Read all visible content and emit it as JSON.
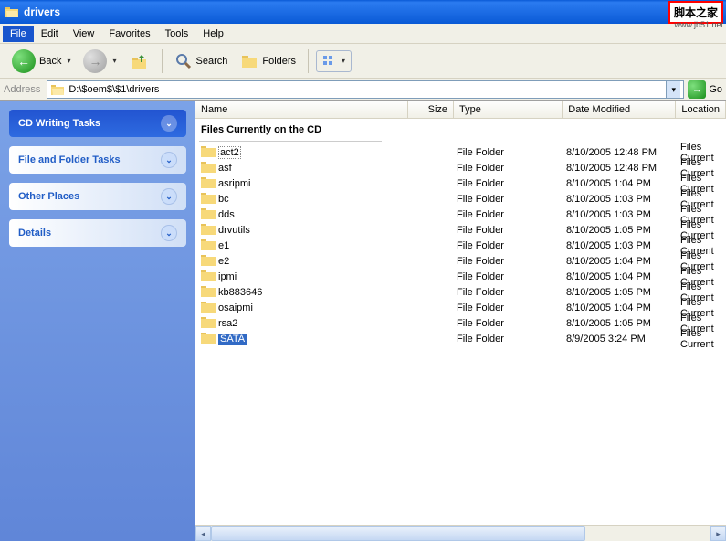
{
  "window": {
    "title": "drivers"
  },
  "watermark": {
    "text": "脚本之家",
    "url": "www.jb51.net"
  },
  "menu": {
    "file": "File",
    "edit": "Edit",
    "view": "View",
    "favorites": "Favorites",
    "tools": "Tools",
    "help": "Help"
  },
  "toolbar": {
    "back": "Back",
    "search": "Search",
    "folders": "Folders"
  },
  "address": {
    "label": "Address",
    "path": "D:\\$oem$\\$1\\drivers",
    "go": "Go"
  },
  "sidebar": {
    "panels": [
      {
        "title": "CD Writing Tasks",
        "primary": true
      },
      {
        "title": "File and Folder Tasks",
        "primary": false
      },
      {
        "title": "Other Places",
        "primary": false
      },
      {
        "title": "Details",
        "primary": false
      }
    ]
  },
  "columns": {
    "name": "Name",
    "size": "Size",
    "type": "Type",
    "date": "Date Modified",
    "location": "Location"
  },
  "section": "Files Currently on the CD",
  "files": [
    {
      "name": "act2",
      "type": "File Folder",
      "date": "8/10/2005 12:48 PM",
      "location": "Files Current",
      "focused": true
    },
    {
      "name": "asf",
      "type": "File Folder",
      "date": "8/10/2005 12:48 PM",
      "location": "Files Current"
    },
    {
      "name": "asripmi",
      "type": "File Folder",
      "date": "8/10/2005 1:04 PM",
      "location": "Files Current"
    },
    {
      "name": "bc",
      "type": "File Folder",
      "date": "8/10/2005 1:03 PM",
      "location": "Files Current"
    },
    {
      "name": "dds",
      "type": "File Folder",
      "date": "8/10/2005 1:03 PM",
      "location": "Files Current"
    },
    {
      "name": "drvutils",
      "type": "File Folder",
      "date": "8/10/2005 1:05 PM",
      "location": "Files Current"
    },
    {
      "name": "e1",
      "type": "File Folder",
      "date": "8/10/2005 1:03 PM",
      "location": "Files Current"
    },
    {
      "name": "e2",
      "type": "File Folder",
      "date": "8/10/2005 1:04 PM",
      "location": "Files Current"
    },
    {
      "name": "ipmi",
      "type": "File Folder",
      "date": "8/10/2005 1:04 PM",
      "location": "Files Current"
    },
    {
      "name": "kb883646",
      "type": "File Folder",
      "date": "8/10/2005 1:05 PM",
      "location": "Files Current"
    },
    {
      "name": "osaipmi",
      "type": "File Folder",
      "date": "8/10/2005 1:04 PM",
      "location": "Files Current"
    },
    {
      "name": "rsa2",
      "type": "File Folder",
      "date": "8/10/2005 1:05 PM",
      "location": "Files Current"
    },
    {
      "name": "SATA",
      "type": "File Folder",
      "date": "8/9/2005 3:24 PM",
      "location": "Files Current",
      "selected": true
    }
  ]
}
